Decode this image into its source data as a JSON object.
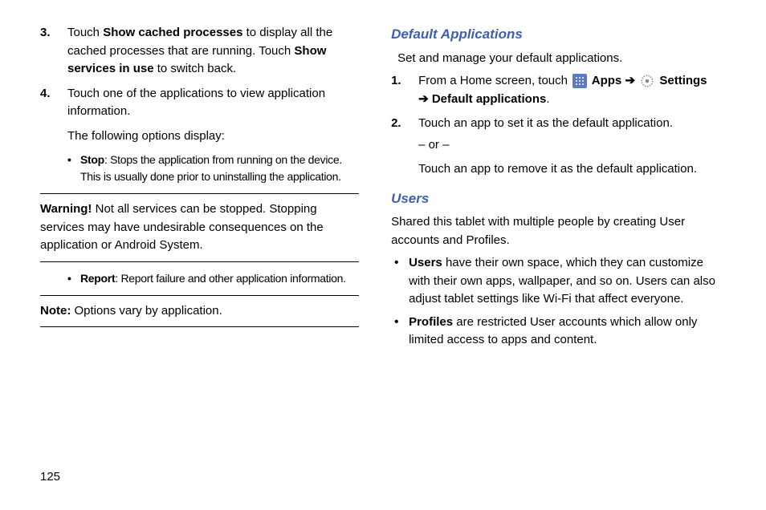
{
  "left": {
    "item3_num": "3.",
    "item3_a": "Touch ",
    "item3_b": "Show cached processes",
    "item3_c": " to display all the cached processes that are running. Touch ",
    "item3_d": "Show services in use",
    "item3_e": " to switch back.",
    "item4_num": "4.",
    "item4_a": "Touch one of the applications to view application information.",
    "item4_sub": "The following options display:",
    "stop_label": "Stop",
    "stop_text": ": Stops the application from running on the device. This is usually done prior to uninstalling the application.",
    "warn_label": "Warning!",
    "warn_text": " Not all services can be stopped. Stopping services may have undesirable consequences on the application or Android System.",
    "report_label": "Report",
    "report_text": ": Report failure and other application information.",
    "note_label": "Note:",
    "note_text": " Options vary by application."
  },
  "right": {
    "h1": "Default Applications",
    "intro1": "Set and manage your default applications.",
    "item1_num": "1.",
    "item1_a": "From a Home screen, touch ",
    "apps_label": " Apps",
    "arrow1": " ➔ ",
    "settings_label": " Settings",
    "arrow2": "➔ ",
    "default_apps_label": "Default applications",
    "period": ".",
    "item2_num": "2.",
    "item2_a": "Touch an app to set it as the default application.",
    "or": "– or –",
    "item2_b": "Touch an app to remove it as the default application.",
    "h2": "Users",
    "intro2": "Shared this tablet with multiple people by creating User accounts and Profiles.",
    "users_label": "Users",
    "users_text": " have their own space, which they can customize with their own apps, wallpaper, and so on. Users can also adjust tablet settings like Wi-Fi that affect everyone.",
    "profiles_label": "Profiles",
    "profiles_text": " are restricted User accounts which allow only limited access to apps and content."
  },
  "page_number": "125"
}
